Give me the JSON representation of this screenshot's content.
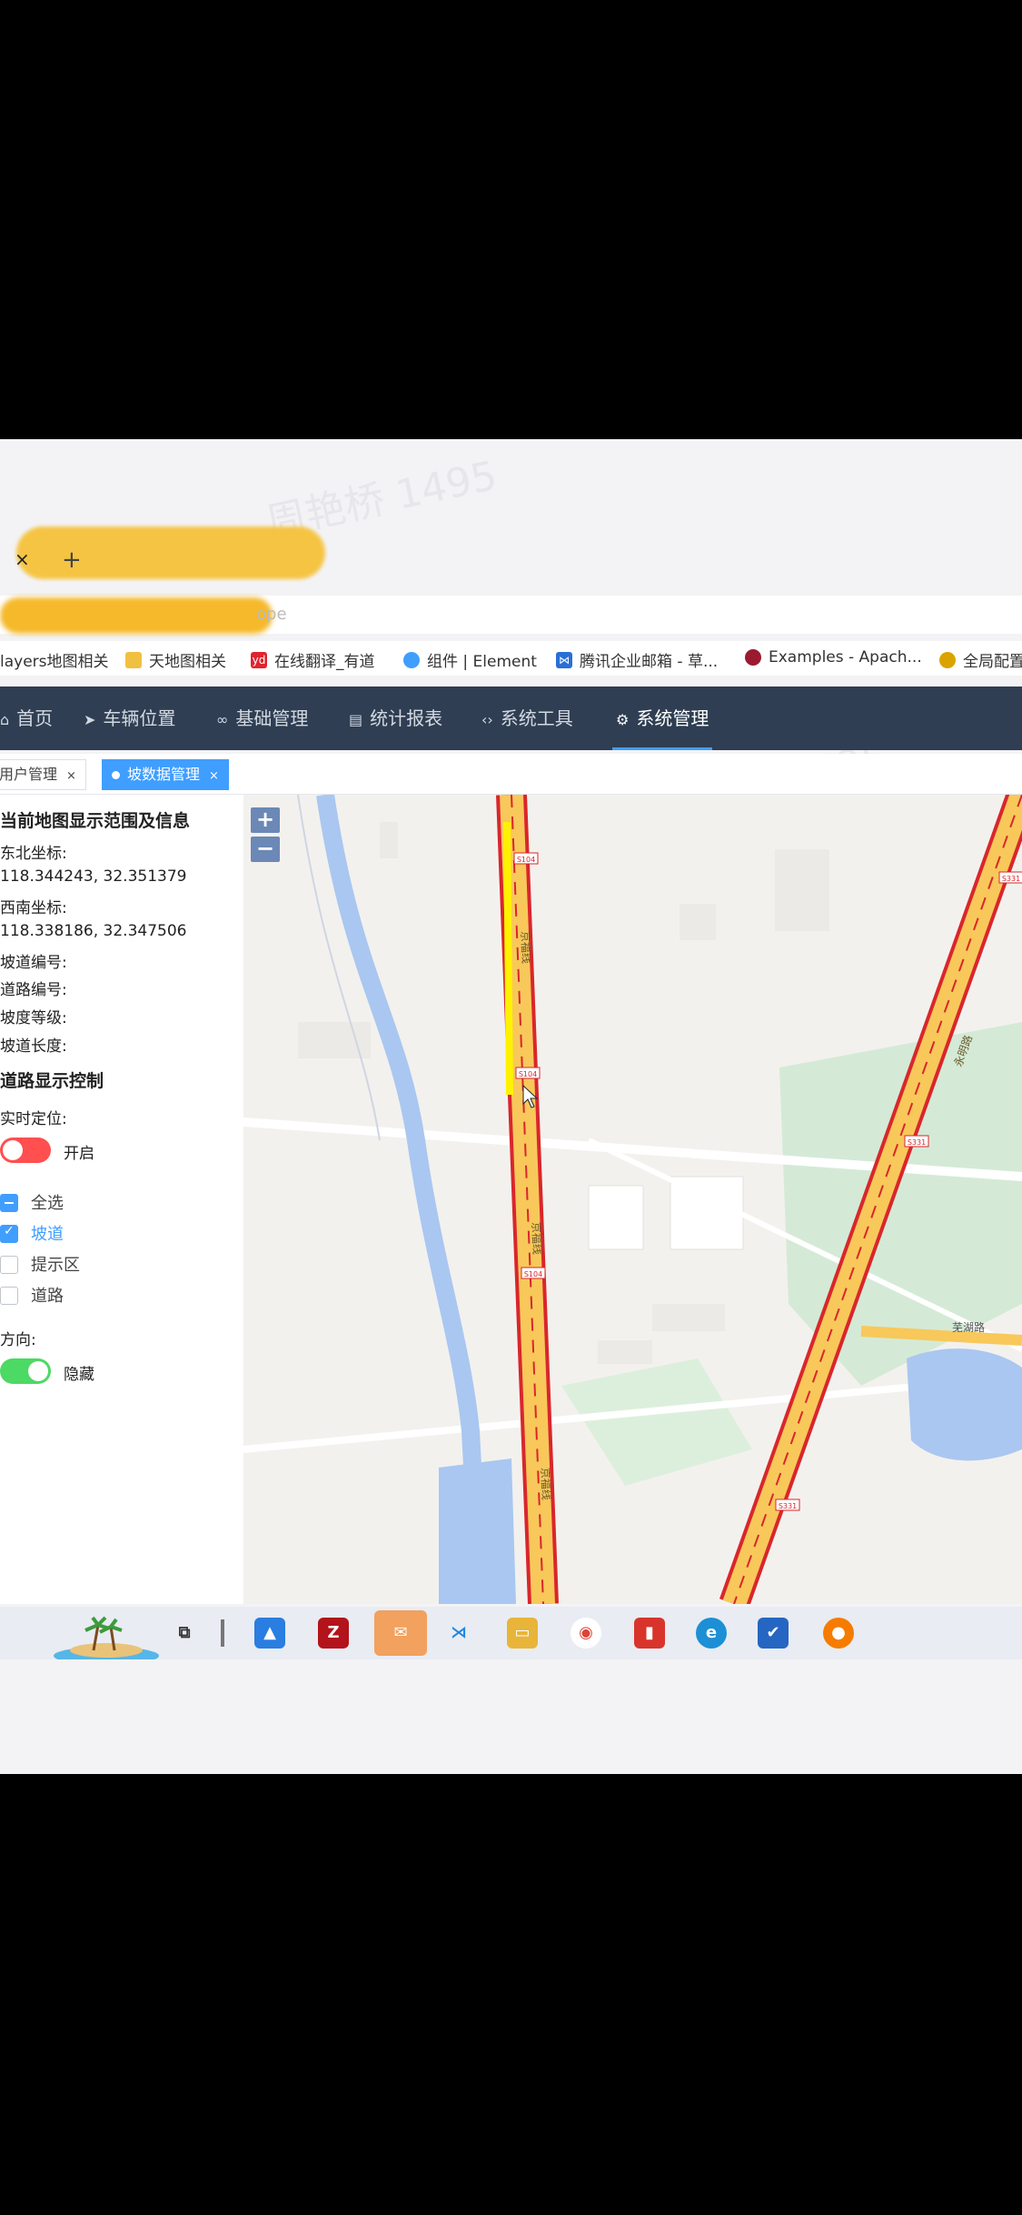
{
  "browser": {
    "close_tab": "×",
    "new_tab": "+",
    "url_tail": "ope"
  },
  "bookmarks": [
    {
      "label": "layers地图相关",
      "icon": "folder-icon",
      "color": "#f0c040"
    },
    {
      "label": "天地图相关",
      "icon": "folder-icon",
      "color": "#f0c040"
    },
    {
      "label": "在线翻译_有道",
      "icon": "youdao-icon",
      "color": "#e0242e"
    },
    {
      "label": "组件 | Element",
      "icon": "element-icon",
      "color": "#409eff"
    },
    {
      "label": "腾讯企业邮箱 - 草...",
      "icon": "tencent-mail-icon",
      "color": "#2a6fd6"
    },
    {
      "label": "Examples - Apach...",
      "icon": "apache-icon",
      "color": "#9a1b2f"
    },
    {
      "label": "全局配置",
      "icon": "star-icon",
      "color": "#d9a400"
    }
  ],
  "nav": [
    {
      "label": "首页",
      "icon": "home-icon",
      "glyph": "⌂"
    },
    {
      "label": "车辆位置",
      "icon": "send-icon",
      "glyph": "➤"
    },
    {
      "label": "基础管理",
      "icon": "link-icon",
      "glyph": "∞"
    },
    {
      "label": "统计报表",
      "icon": "document-icon",
      "glyph": "▤"
    },
    {
      "label": "系统工具",
      "icon": "code-icon",
      "glyph": "‹›"
    },
    {
      "label": "系统管理",
      "icon": "gear-icon",
      "glyph": "⚙"
    }
  ],
  "page_tabs": [
    {
      "label": "用户管理",
      "close": "×"
    },
    {
      "label": "坡数据管理",
      "close": "×"
    }
  ],
  "panel": {
    "section1_title": "当前地图显示范围及信息",
    "ne_label": "东北坐标:",
    "ne_value": "118.344243, 32.351379",
    "sw_label": "西南坐标:",
    "sw_value": "118.338186, 32.347506",
    "ramp_no": "坡道编号:",
    "road_no": "道路编号:",
    "slope_level": "坡度等级:",
    "ramp_length": "坡道长度:",
    "section2_title": "道路显示控制",
    "realtime_label": "实时定位:",
    "realtime_state": "开启",
    "checkboxes": [
      "全选",
      "坡道",
      "提示区",
      "道路"
    ],
    "direction_label": "方向:",
    "direction_state": "隐藏"
  },
  "map": {
    "zoom_in": "+",
    "zoom_out": "−",
    "road_labels": [
      "京福线",
      "京福线",
      "京福线",
      "永明路",
      "芜湖路"
    ],
    "road_codes": [
      "S104",
      "S104",
      "S104",
      "S331",
      "S331",
      "S331"
    ]
  },
  "watermark": "周艳桥 1495",
  "colors": {
    "nav_bg": "#2f3e52",
    "accent": "#409eff",
    "road_red": "#d9262c",
    "road_fill": "#f8c85a",
    "water": "#a9c7f0",
    "green": "#cfe8d3"
  }
}
